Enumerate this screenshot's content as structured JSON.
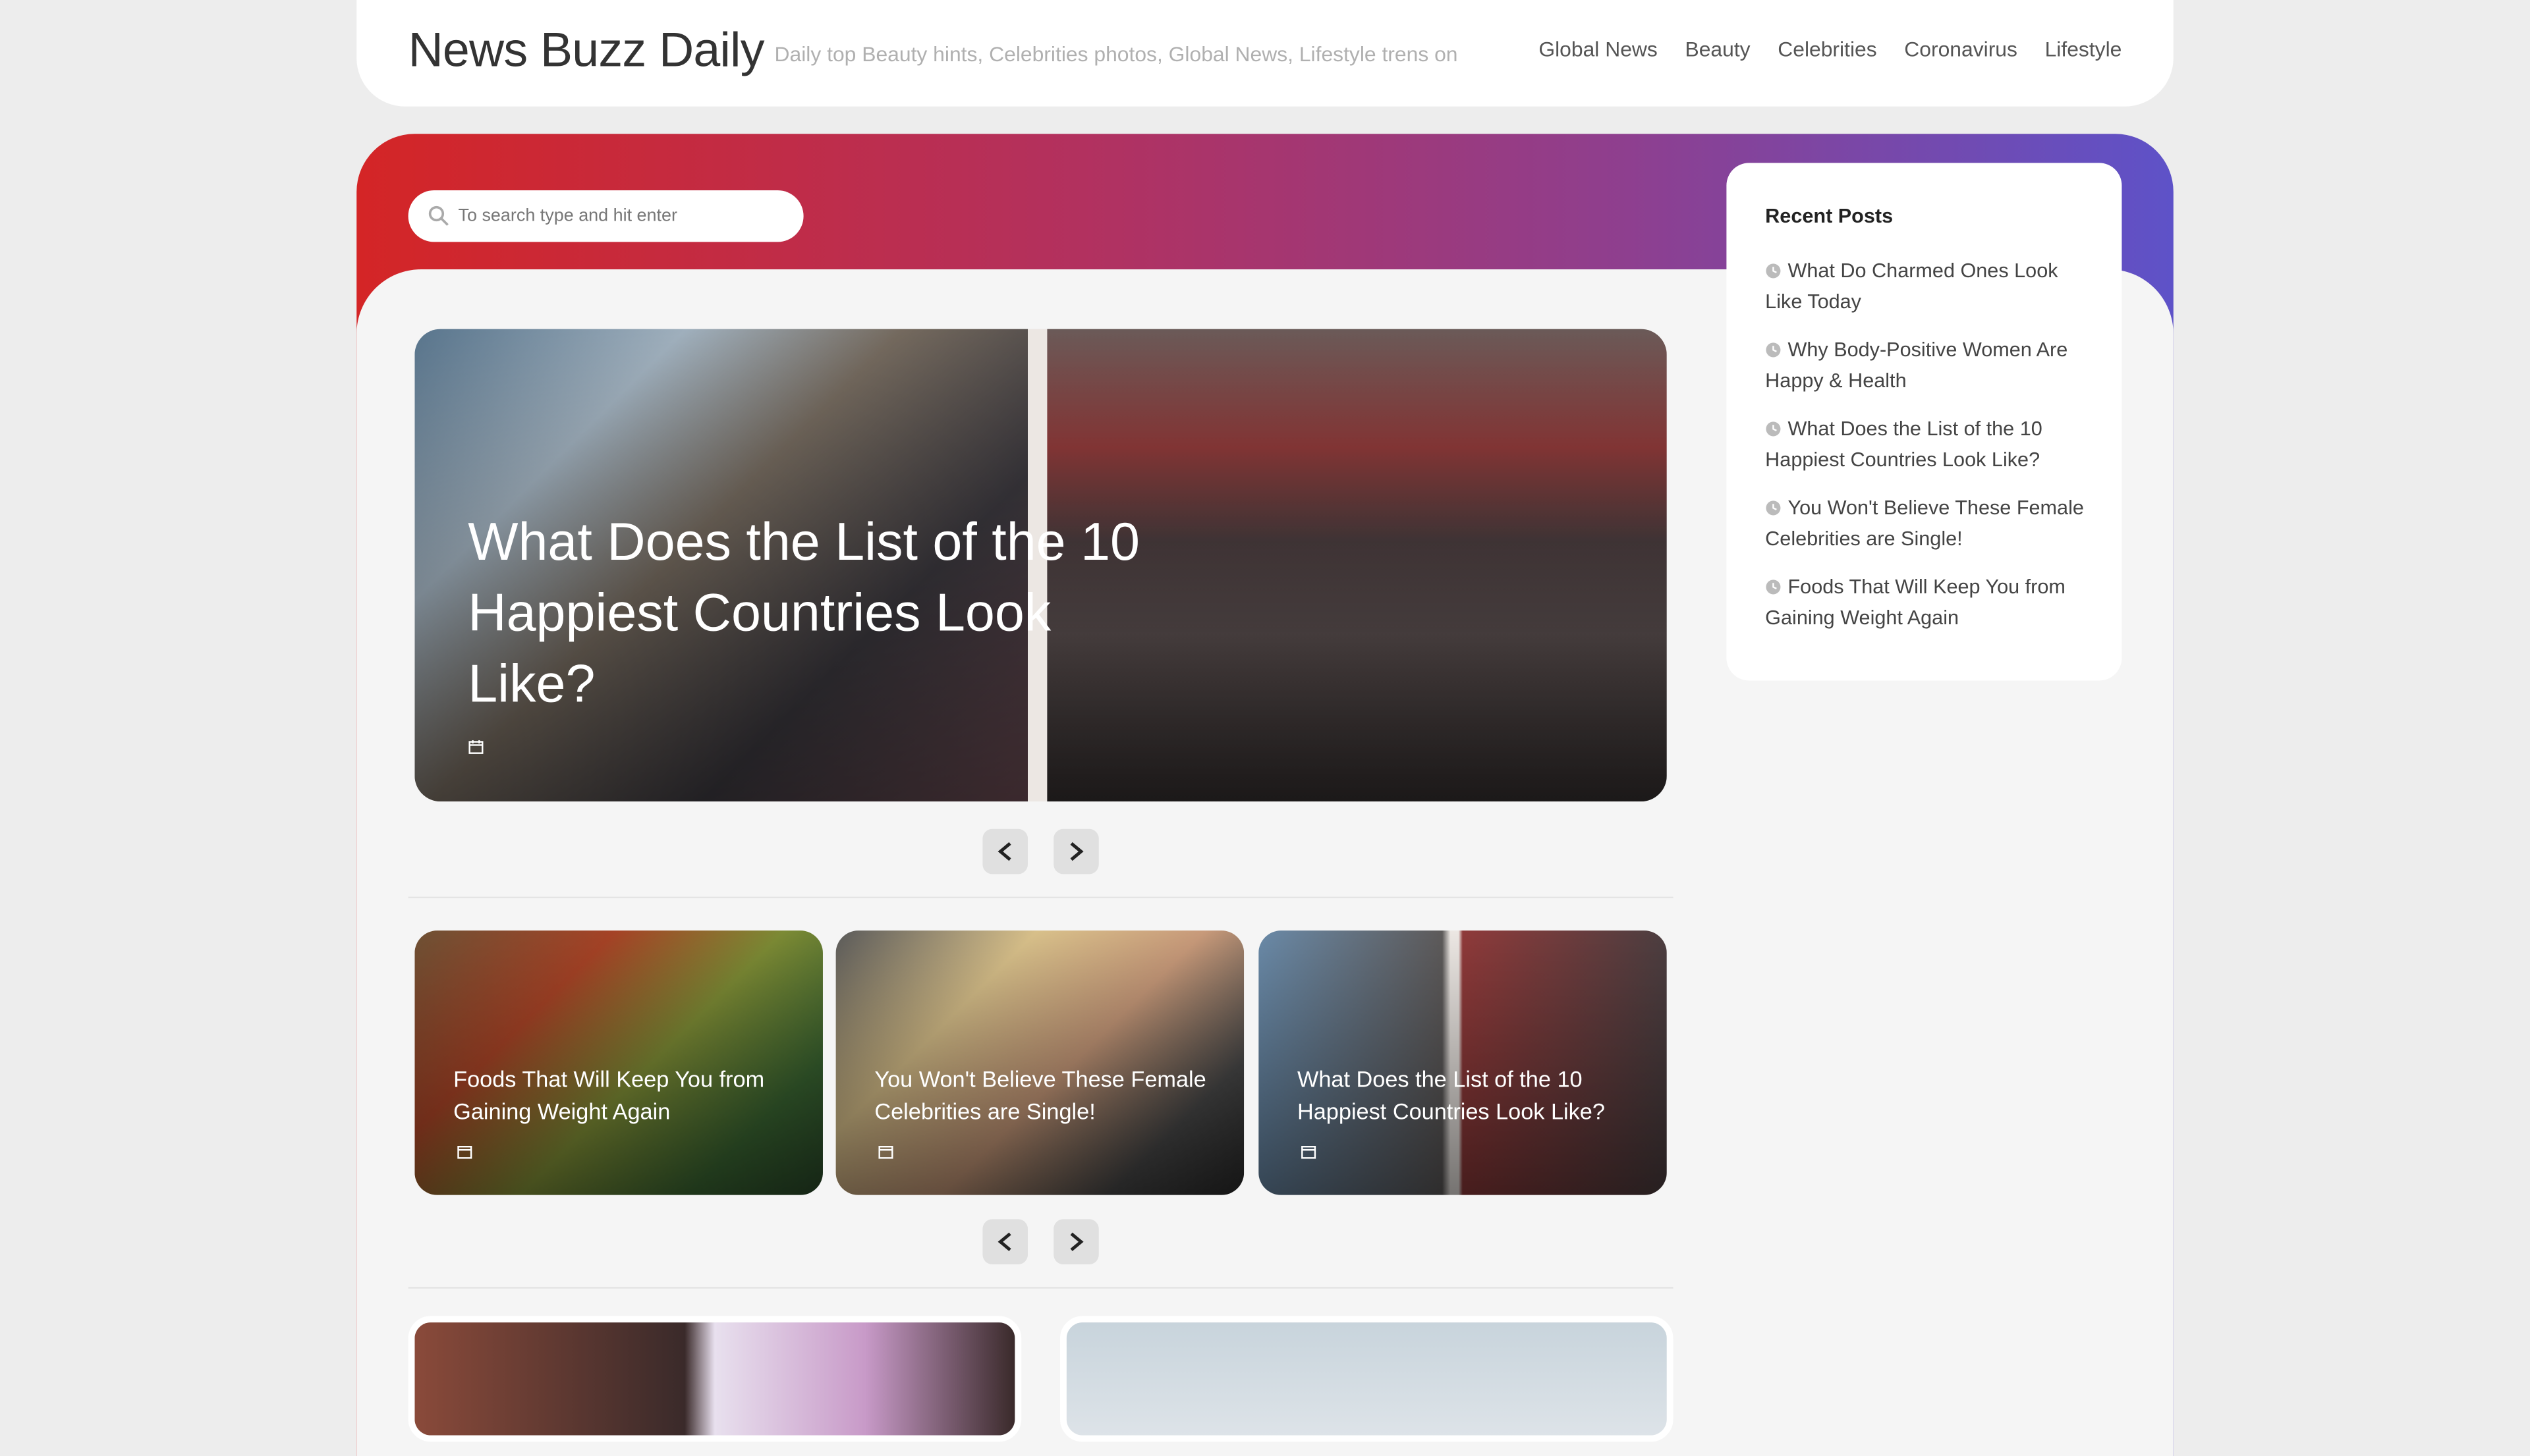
{
  "header": {
    "site_title": "News Buzz Daily",
    "tagline": "Daily top Beauty hints, Celebrities photos, Global News, Lifestyle trens on",
    "nav": [
      "Global News",
      "Beauty",
      "Celebrities",
      "Coronavirus",
      "Lifestyle"
    ]
  },
  "search": {
    "placeholder": "To search type and hit enter"
  },
  "featured": {
    "title": "What Does the List of the 10 Happiest Countries Look Like?"
  },
  "cards": [
    {
      "title": "Foods That Will Keep You from Gaining Weight Again"
    },
    {
      "title": "You Won't Believe These Female Celebrities are Single!"
    },
    {
      "title": "What Does the List of the 10 Happiest Countries Look Like?"
    }
  ],
  "sidebar": {
    "heading": "Recent Posts",
    "items": [
      "What Do Charmed Ones Look Like Today",
      "Why Body-Positive Women Are Happy & Health",
      "What Does the List of the 10 Happiest Countries Look Like?",
      "You Won't Believe These Female Celebrities are Single!",
      "Foods That Will Keep You from Gaining Weight Again"
    ]
  },
  "colors": {
    "gradient_start": "#d42526",
    "gradient_end": "#5e52c8",
    "page_bg": "#ededed"
  },
  "icons": {
    "search": "search-icon",
    "date": "calendar-icon",
    "prev": "chevron-left-icon",
    "next": "chevron-right-icon",
    "bullet": "clock-icon"
  }
}
